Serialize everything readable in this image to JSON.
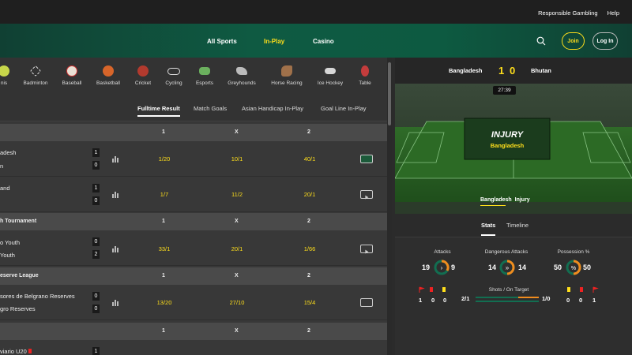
{
  "topbar": {
    "responsible": "Responsible Gambling",
    "help": "Help"
  },
  "nav": {
    "all_sports": "All Sports",
    "in_play": "In-Play",
    "casino": "Casino",
    "join": "Join",
    "login": "Log In"
  },
  "sports": [
    "nis",
    "Badminton",
    "Baseball",
    "Basketball",
    "Cricket",
    "Cycling",
    "Esports",
    "Greyhounds",
    "Horse Racing",
    "Ice Hockey",
    "Table"
  ],
  "market_tabs": [
    "Fulltime Result",
    "Match Goals",
    "Asian Handicap In-Play",
    "Goal Line In-Play"
  ],
  "col_labels": {
    "one": "1",
    "x": "X",
    "two": "2"
  },
  "sections": [
    {
      "name": ""
    },
    {
      "name": "h Tournament"
    },
    {
      "name": "eserve League"
    },
    {
      "name": ""
    }
  ],
  "matches": [
    {
      "team1": "adesh",
      "team2": "n",
      "s1": "1",
      "s2": "0",
      "o1": "1/20",
      "ox": "10/1",
      "o2": "40/1"
    },
    {
      "team1": "and",
      "team2": "",
      "s1": "1",
      "s2": "0",
      "o1": "1/7",
      "ox": "11/2",
      "o2": "20/1"
    },
    {
      "team1": "o Youth",
      "team2": "Youth",
      "s1": "0",
      "s2": "2",
      "o1": "33/1",
      "ox": "20/1",
      "o2": "1/66"
    },
    {
      "team1": "sores de Belgrano Reserves",
      "team2": "gro Reserves",
      "s1": "0",
      "s2": "0",
      "o1": "13/20",
      "ox": "27/10",
      "o2": "15/4"
    },
    {
      "team1": "viario U20",
      "team2": "",
      "s1": "1",
      "s2": "",
      "o1": "",
      "ox": "",
      "o2": ""
    }
  ],
  "match": {
    "home": "Bangladesh",
    "away": "Bhutan",
    "home_score": "1",
    "away_score": "0",
    "clock": "27:39",
    "event_title": "INJURY",
    "event_team": "Bangladesh",
    "ticker_team": "Bangladesh",
    "ticker_event": "Injury"
  },
  "stats_tabs": {
    "stats": "Stats",
    "timeline": "Timeline"
  },
  "stats": {
    "attacks_label": "Attacks",
    "attacks_home": "19",
    "attacks_away": "9",
    "danger_label": "Dangerous Attacks",
    "danger_home": "14",
    "danger_away": "14",
    "poss_label": "Possession %",
    "poss_home": "50",
    "poss_away": "50",
    "shots_label": "Shots / On Target",
    "shots_home": "2/1",
    "shots_away": "1/0",
    "home_cards": [
      "1",
      "0",
      "0"
    ],
    "away_cards": [
      "0",
      "0",
      "1"
    ]
  },
  "colors": {
    "accent": "#ffdf1b",
    "green": "#126e51",
    "orange": "#f08c1e"
  }
}
